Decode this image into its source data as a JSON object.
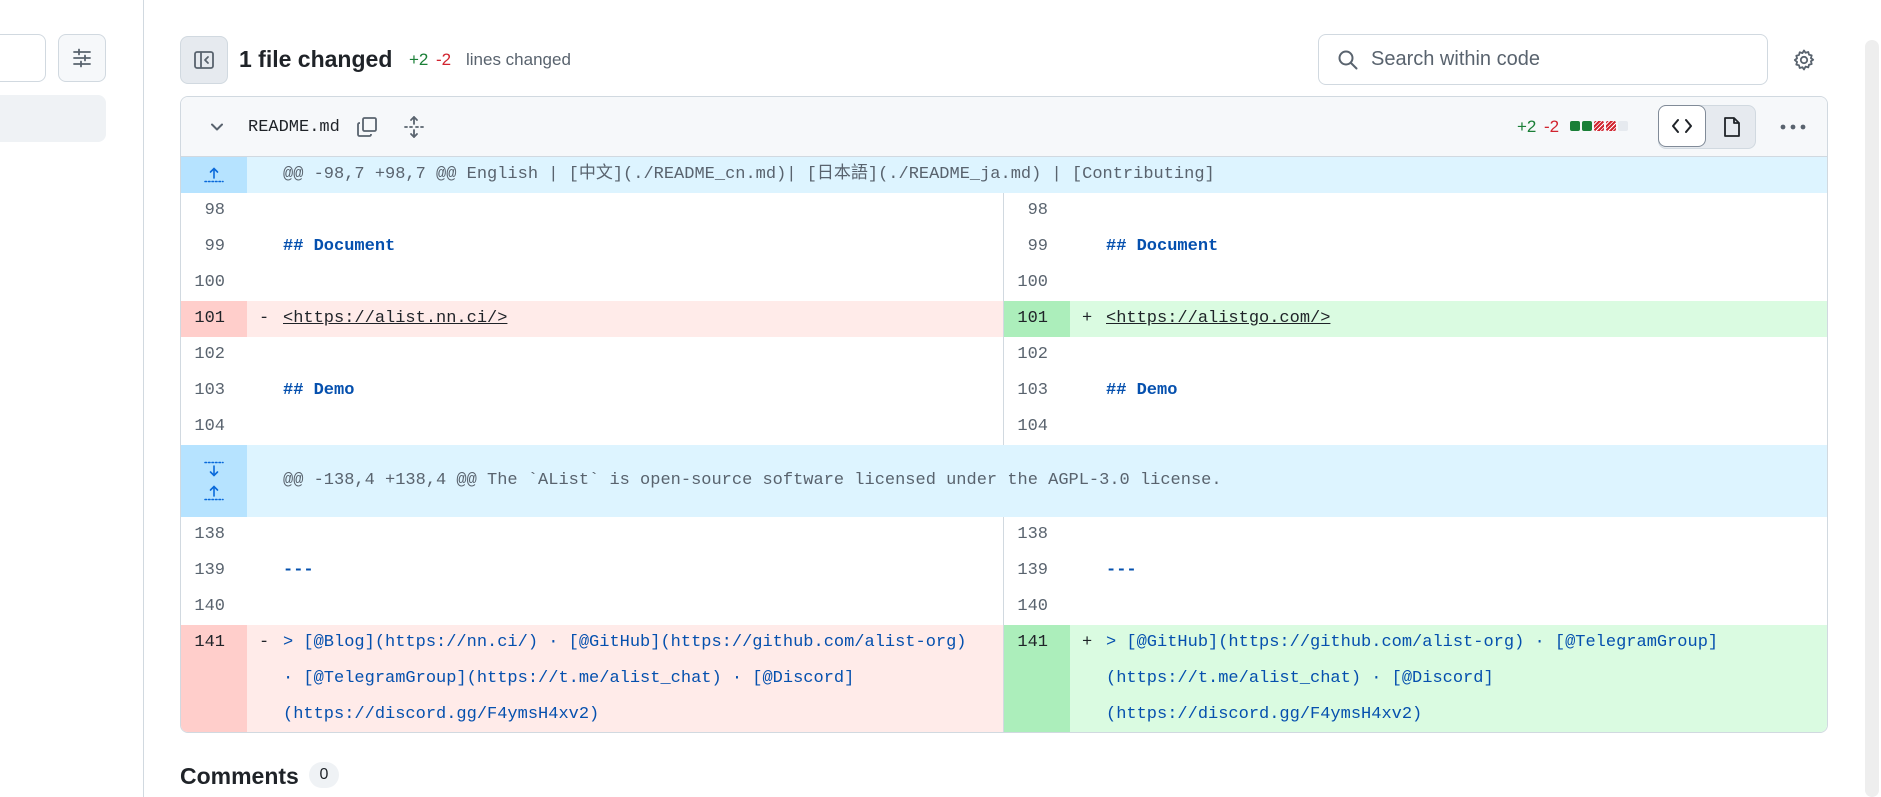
{
  "toolbar": {
    "files_changed": "1 file changed",
    "additions": "+2",
    "deletions": "-2",
    "lines_changed": "lines changed",
    "search_placeholder": "Search within code"
  },
  "file": {
    "name": "README.md",
    "additions": "+2",
    "deletions": "-2",
    "diffstat_blocks": [
      "added",
      "added",
      "deleted",
      "deleted",
      "neutral"
    ]
  },
  "hunks": [
    {
      "header": "@@ -98,7 +98,7 @@ English | [中文](./README_cn.md)| [日本語](./README_ja.md) | [Contributing]",
      "lines": [
        {
          "left_num": "98",
          "right_num": "98",
          "left": "",
          "right": ""
        },
        {
          "left_num": "99",
          "right_num": "99",
          "left": "## Document",
          "right": "## Document"
        },
        {
          "left_num": "100",
          "right_num": "100",
          "left": "",
          "right": ""
        },
        {
          "left_num": "101",
          "right_num": "101",
          "left_sign": "-",
          "right_sign": "+",
          "left": "<https://alist.nn.ci/>",
          "right": "<https://alistgo.com/>"
        },
        {
          "left_num": "102",
          "right_num": "102",
          "left": "",
          "right": ""
        },
        {
          "left_num": "103",
          "right_num": "103",
          "left": "## Demo",
          "right": "## Demo"
        },
        {
          "left_num": "104",
          "right_num": "104",
          "left": "",
          "right": ""
        }
      ]
    },
    {
      "header": "@@ -138,4 +138,4 @@ The `AList` is open-source software licensed under the AGPL-3.0 license.",
      "lines": [
        {
          "left_num": "138",
          "right_num": "138",
          "left": "",
          "right": ""
        },
        {
          "left_num": "139",
          "right_num": "139",
          "left": "---",
          "right": "---"
        },
        {
          "left_num": "140",
          "right_num": "140",
          "left": "",
          "right": ""
        },
        {
          "left_num": "141",
          "right_num": "141",
          "left_sign": "-",
          "right_sign": "+",
          "left": "> [@Blog](https://nn.ci/) · [@GitHub](https://github.com/alist-org) · [@TelegramGroup](https://t.me/alist_chat) · [@Discord](https://discord.gg/F4ymsH4xv2)",
          "right": "> [@GitHub](https://github.com/alist-org) · [@TelegramGroup](https://t.me/alist_chat) · [@Discord](https://discord.gg/F4ymsH4xv2)"
        }
      ]
    }
  ],
  "comments": {
    "label": "Comments",
    "count": "0"
  },
  "colors": {
    "addition": "#1a7f37",
    "deletion": "#d1242f",
    "hunk_bg": "#ddf4ff",
    "del_bg": "#ffebe9",
    "add_bg": "#dafbe1"
  }
}
